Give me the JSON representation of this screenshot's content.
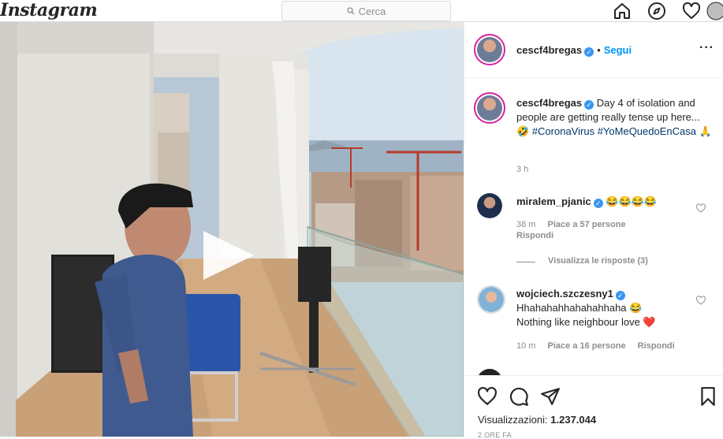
{
  "app": {
    "logo": "Instagram"
  },
  "search": {
    "placeholder": "Cerca"
  },
  "nav": {
    "icons": [
      "home-icon",
      "explore-icon",
      "heart-icon"
    ]
  },
  "post": {
    "author": "cescf4bregas",
    "follow_label": "Segui",
    "caption_author": "cescf4bregas",
    "caption_text": "Day 4 of isolation and people are getting really tense up here... 🤣",
    "hashtag1": "#CoronaVirus",
    "hashtag2": "#YoMeQuedoEnCasa",
    "caption_emoji": "🙏",
    "caption_time": "3 h",
    "views_label": "Visualizzazioni:",
    "views_count": "1.237.044",
    "date_partial": "2 ORE FA"
  },
  "comments": [
    {
      "user": "miralem_pjanic",
      "text": "😂😂😂😂",
      "time": "38 m",
      "likes": "Piace a 57 persone",
      "reply": "Rispondi",
      "view_replies": "Visualizza le risposte (3)"
    },
    {
      "user": "wojciech.szczesny1",
      "text_line1": "Hhahahahhahahahhaha 😂",
      "text_line2": "Nothing like neighbour love ❤️",
      "time": "10 m",
      "likes": "Piace a 16 persone",
      "reply": "Rispondi"
    }
  ],
  "colors": {
    "accent": "#0095f6",
    "verified": "#3897f0",
    "hashtag": "#00376b",
    "story_ring": "#d6249f",
    "heart_red": "#ed4956"
  }
}
